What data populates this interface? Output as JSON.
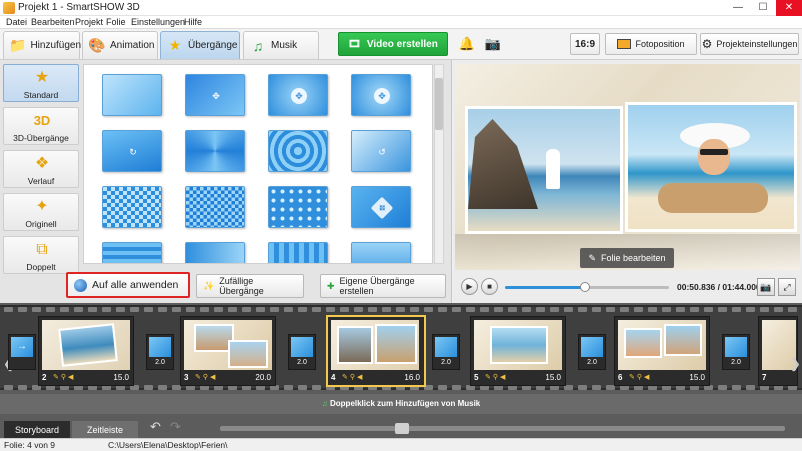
{
  "window": {
    "title": "Projekt 1 - SmartSHOW 3D"
  },
  "menu": [
    "Datei",
    "Bearbeiten",
    "Projekt",
    "Folie",
    "Einstellungen",
    "Hilfe"
  ],
  "tabs": [
    {
      "label": "Hinzufügen",
      "icon": "folder-icon"
    },
    {
      "label": "Animation",
      "icon": "palette-icon"
    },
    {
      "label": "Übergänge",
      "icon": "star-icon",
      "active": true
    },
    {
      "label": "Musik",
      "icon": "music-icon"
    }
  ],
  "toolbar": {
    "video_button": "Video erstellen",
    "ratio": "16:9",
    "photo_position": "Fotoposition",
    "project_settings": "Projekteinstellungen"
  },
  "categories": [
    {
      "label": "Standard",
      "icon": "star-icon",
      "active": true
    },
    {
      "label": "3D-Übergänge",
      "icon": "3d-icon"
    },
    {
      "label": "Verlauf",
      "icon": "gradient-icon"
    },
    {
      "label": "Originell",
      "icon": "puzzle-icon"
    },
    {
      "label": "Doppelt",
      "icon": "double-icon"
    }
  ],
  "transitions_panel": {
    "apply_all": "Auf alle anwenden",
    "random": "Zufällige Übergänge",
    "custom": "Eigene Übergänge erstellen"
  },
  "preview": {
    "edit_slide": "Folie bearbeiten",
    "timecode": "00:50.836 / 01:44.000",
    "progress": 0.49
  },
  "storyboard": {
    "slides": [
      {
        "num": "2",
        "duration": "15.0"
      },
      {
        "num": "3",
        "duration": "20.0"
      },
      {
        "num": "4",
        "duration": "16.0",
        "active": true
      },
      {
        "num": "5",
        "duration": "15.0"
      },
      {
        "num": "6",
        "duration": "15.0"
      },
      {
        "num": "7",
        "duration": ""
      }
    ],
    "transitions": [
      "2.0",
      "2.0",
      "2.0",
      "2.0",
      "2.0"
    ],
    "music_hint": "Doppelklick zum Hinzufügen von Musik",
    "tab_storyboard": "Storyboard",
    "tab_timeline": "Zeitleiste"
  },
  "status": {
    "slide": "Folie: 4 von 9",
    "path": "C:\\Users\\Elena\\Desktop\\Ferien\\"
  },
  "colors": {
    "accent": "#2e90d9",
    "video_button": "#1fa33a",
    "highlight": "#e02424",
    "active_slide": "#f2c94c"
  }
}
